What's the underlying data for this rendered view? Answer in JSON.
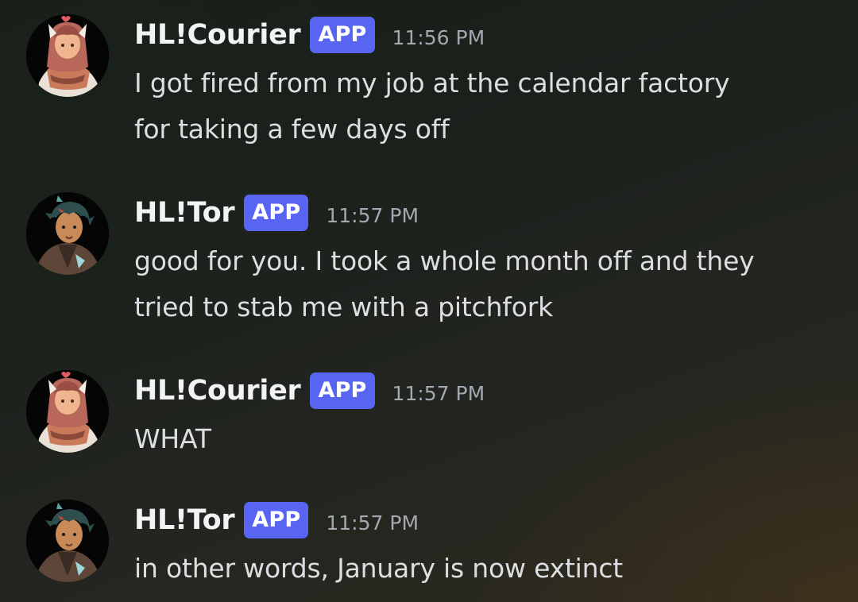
{
  "messages": [
    {
      "author": "HL!Courier",
      "tag": "APP",
      "time": "11:56 PM",
      "lines": [
        "I got fired from my job at the calendar factory",
        "for taking a few days off"
      ],
      "avatar": "courier-avatar"
    },
    {
      "author": "HL!Tor",
      "tag": "APP",
      "time": "11:57 PM",
      "lines": [
        "good for you. I took a whole month off and they",
        "tried to stab me with a pitchfork"
      ],
      "avatar": "tor-avatar"
    },
    {
      "author": "HL!Courier",
      "tag": "APP",
      "time": "11:57 PM",
      "lines": [
        "WHAT"
      ],
      "avatar": "courier-avatar"
    },
    {
      "author": "HL!Tor",
      "tag": "APP",
      "time": "11:57 PM",
      "lines": [
        "in other words, January is now extinct"
      ],
      "avatar": "tor-avatar"
    }
  ],
  "colors": {
    "app_tag": "#5865f2",
    "username": "#f2f3f5",
    "message_text": "#dcdee1",
    "timestamp": "#a4a8b0"
  }
}
